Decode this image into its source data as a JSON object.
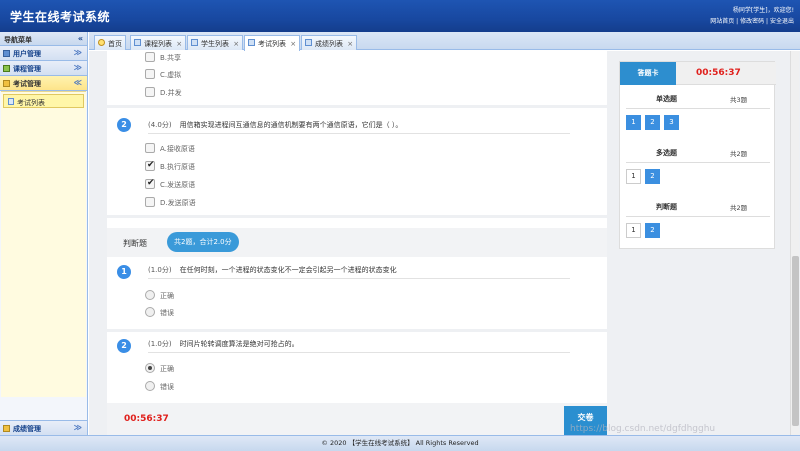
{
  "header": {
    "title": "学生在线考试系统",
    "welcome": "杨同学[学生]，欢迎您!",
    "links": [
      "网站首页",
      "修改密码",
      "安全退出"
    ],
    "link_sep": "|"
  },
  "sidebar": {
    "title": "导航菜单",
    "collapse": "«",
    "items": [
      {
        "label": "用户管理",
        "expanded": false
      },
      {
        "label": "课程管理",
        "expanded": false
      },
      {
        "label": "考试管理",
        "expanded": true
      }
    ],
    "sub_items": [
      {
        "label": "考试列表"
      }
    ],
    "bottom_item": {
      "label": "成绩管理"
    },
    "chevron_down": "≫",
    "chevron_up": "≪"
  },
  "tabs": [
    {
      "label": "首页",
      "closable": false,
      "active": false,
      "icon": "bulb-icon"
    },
    {
      "label": "课程列表",
      "closable": true,
      "active": false,
      "icon": "page-icon"
    },
    {
      "label": "学生列表",
      "closable": true,
      "active": false,
      "icon": "page-icon"
    },
    {
      "label": "考试列表",
      "closable": true,
      "active": true,
      "icon": "page-icon"
    },
    {
      "label": "成绩列表",
      "closable": true,
      "active": false,
      "icon": "page-icon"
    }
  ],
  "tab_close": "×",
  "exam": {
    "q1_tail_options": [
      {
        "label": "B.共享",
        "checked": false
      },
      {
        "label": "C.虚拟",
        "checked": false
      },
      {
        "label": "D.并发",
        "checked": false
      }
    ],
    "multi_q2": {
      "number": "2",
      "score": "(4.0分)",
      "text": "用信箱实现进程间互通信息的通信机制要有两个通信原语，它们是（ ）。",
      "options": [
        {
          "label": "A.接收原语",
          "checked": false
        },
        {
          "label": "B.执行原语",
          "checked": true
        },
        {
          "label": "C.发送原语",
          "checked": true
        },
        {
          "label": "D.发送原语",
          "checked": false
        }
      ]
    },
    "judge_section": {
      "name": "判断题",
      "summary": "共2题，合计2.0分"
    },
    "judge_questions": [
      {
        "number": "1",
        "score": "(1.0分)",
        "text": "在任何时刻，一个进程的状态变化不一定会引起另一个进程的状态变化",
        "options": [
          {
            "label": "正确",
            "checked": false
          },
          {
            "label": "错误",
            "checked": false
          }
        ]
      },
      {
        "number": "2",
        "score": "(1.0分)",
        "text": "时间片轮转调度算法是绝对可抢占的。",
        "options": [
          {
            "label": "正确",
            "checked": true
          },
          {
            "label": "错误",
            "checked": false
          }
        ]
      }
    ],
    "timer": "00:56:37",
    "submit_label": "交卷"
  },
  "answer_card": {
    "title": "答题卡",
    "timer": "00:56:37",
    "groups": [
      {
        "name": "单选题",
        "count": "共3题",
        "numbers": [
          "1",
          "2",
          "3"
        ],
        "answered": [
          true,
          true,
          true
        ]
      },
      {
        "name": "多选题",
        "count": "共2题",
        "numbers": [
          "1",
          "2"
        ],
        "answered": [
          false,
          true
        ]
      },
      {
        "name": "判断题",
        "count": "共2题",
        "numbers": [
          "1",
          "2"
        ],
        "answered": [
          false,
          true
        ]
      }
    ]
  },
  "footer": {
    "copyright": "© 2020 【学生在线考试系统】 All Rights Reserved"
  },
  "watermark": "https://blog.csdn.net/dgfdhgghu",
  "colors": {
    "header_blue": "#1848a0",
    "accent_blue": "#2d8ecf",
    "timer_red": "#e0201c",
    "active_menu": "#fde48a"
  }
}
